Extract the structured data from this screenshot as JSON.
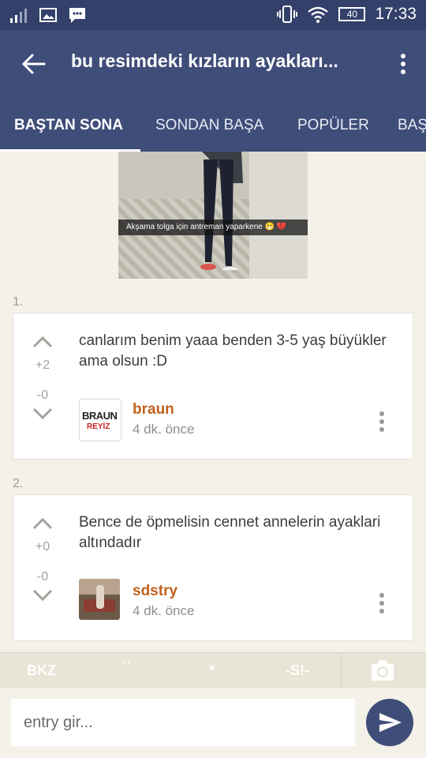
{
  "status": {
    "battery": "40",
    "time": "17:33"
  },
  "header": {
    "title": "bu resimdeki kızların ayakları..."
  },
  "tabs": [
    "BAŞTAN SONA",
    "SONDAN BAŞA",
    "POPÜLER",
    "BAŞ"
  ],
  "image": {
    "caption": "Akşama tolga için antreman yaparkene 😁 💔"
  },
  "entries": [
    {
      "index": "1.",
      "text": "canlarım benim yaaa benden 3-5 yaş büyükler ama olsun :D",
      "up": "+2",
      "down": "-0",
      "author": "braun",
      "time": "4 dk. önce",
      "avatar_text": "BRAUN",
      "avatar_sub": "REYİZ"
    },
    {
      "index": "2.",
      "text": "Bence de öpmelisin cennet annelerin ayaklari altındadır",
      "up": "+0",
      "down": "-0",
      "author": "sdstry",
      "time": "4 dk. önce"
    }
  ],
  "toolbar": {
    "bkz": "BKZ",
    "backtick": "``",
    "star": "*",
    "spoiler": "-S!-"
  },
  "composer": {
    "placeholder": "entry gir..."
  },
  "colors": {
    "appbar": "#3f4d79",
    "author": "#c0621f",
    "background": "#f3f1e8"
  }
}
